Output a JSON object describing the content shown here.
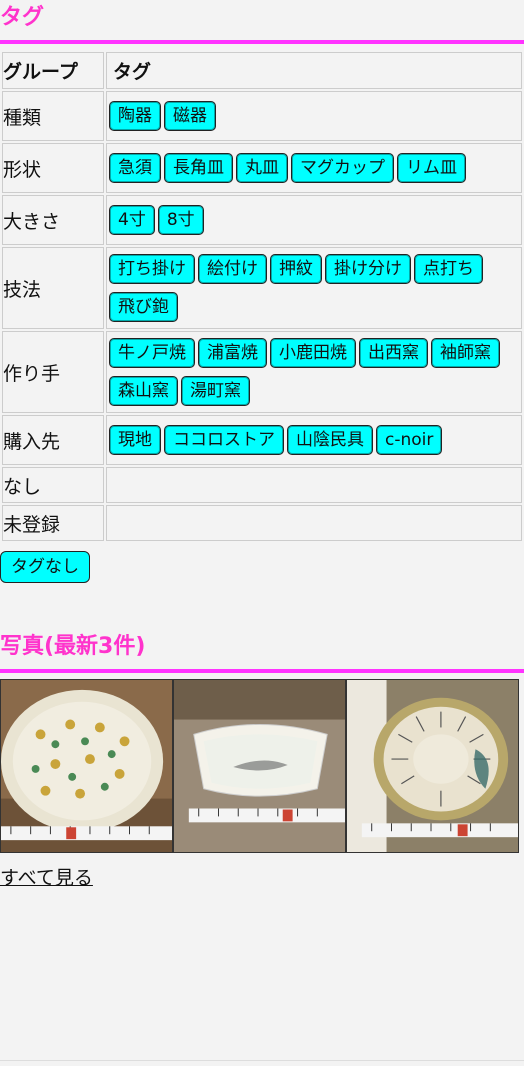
{
  "tags_section": {
    "title": "タグ",
    "header_group": "グループ",
    "header_tag": "タグ",
    "groups": [
      {
        "name": "種類",
        "tags": [
          "陶器",
          "磁器"
        ]
      },
      {
        "name": "形状",
        "tags": [
          "急須",
          "長角皿",
          "丸皿",
          "マグカップ",
          "リム皿"
        ]
      },
      {
        "name": "大きさ",
        "tags": [
          "4寸",
          "8寸"
        ]
      },
      {
        "name": "技法",
        "tags": [
          "打ち掛け",
          "絵付け",
          "押紋",
          "掛け分け",
          "点打ち",
          "飛び鉋"
        ]
      },
      {
        "name": "作り手",
        "tags": [
          "牛ノ戸焼",
          "浦富焼",
          "小鹿田焼",
          "出西窯",
          "袖師窯",
          "森山窯",
          "湯町窯"
        ]
      },
      {
        "name": "購入先",
        "tags": [
          "現地",
          "ココロストア",
          "山陰民具",
          "c-noir"
        ]
      },
      {
        "name": "なし",
        "tags": []
      },
      {
        "name": "未登録",
        "tags": []
      }
    ],
    "no_tag_button": "タグなし"
  },
  "photos_section": {
    "title": "写真(最新3件)",
    "photos": [
      {
        "alt": "dotted-bowl-photo"
      },
      {
        "alt": "rectangular-dish-photo"
      },
      {
        "alt": "striped-plate-photo"
      }
    ],
    "see_all_link": "すべて見る"
  },
  "colors": {
    "accent": "#ff33cc",
    "chip": "#00ffff"
  }
}
